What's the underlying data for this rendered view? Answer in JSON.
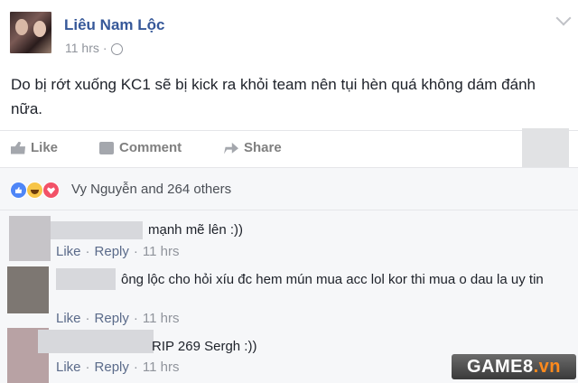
{
  "post": {
    "author": "Liêu Nam Lộc",
    "time": "11 hrs",
    "privacy_icon": "globe-icon",
    "content": "Do bị rớt xuống KC1 sẽ bị kick ra khỏi team nên tụi hèn quá không dám đánh nữa."
  },
  "actions": {
    "like": "Like",
    "comment": "Comment",
    "share": "Share"
  },
  "reactions": {
    "summary": "Vy Nguyễn and 264 others",
    "types": [
      "like",
      "haha",
      "love"
    ]
  },
  "comments": [
    {
      "text": "mạnh mẽ lên :))",
      "like": "Like",
      "reply": "Reply",
      "time": "11 hrs"
    },
    {
      "text": "ông lộc cho hỏi xíu đc hem mún mua acc lol kor thi mua o dau la uy tin",
      "like": "Like",
      "reply": "Reply",
      "time": "11 hrs"
    },
    {
      "text": "RIP 269 Sergh :))",
      "like": "Like",
      "reply": "Reply",
      "time": "11 hrs"
    }
  ],
  "watermark": {
    "main": "GAME8",
    "suffix": ".vn"
  },
  "colors": {
    "link": "#365899",
    "muted": "#90949c",
    "bg_comments": "#f6f7f9"
  }
}
